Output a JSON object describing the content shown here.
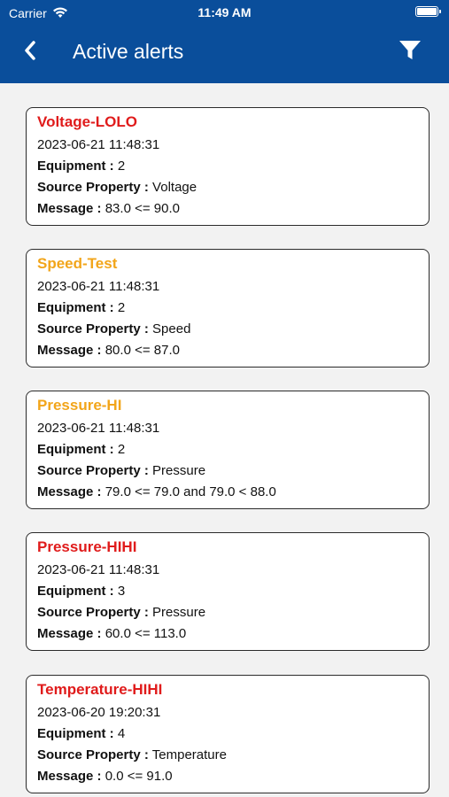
{
  "status_bar": {
    "carrier": "Carrier",
    "time": "11:49 AM"
  },
  "header": {
    "title": "Active alerts",
    "back_icon": "chevron-left-icon",
    "filter_icon": "filter-icon"
  },
  "colors": {
    "header_bg": "#0a4e9b",
    "critical": "#e01b1b",
    "warning": "#f2a51a"
  },
  "labels": {
    "equipment": "Equipment :",
    "source_property": "Source Property :",
    "message": "Message :"
  },
  "alerts": [
    {
      "title": "Voltage-LOLO",
      "severity_color": "#e01b1b",
      "timestamp": "2023-06-21 11:48:31",
      "equipment": "2",
      "source_property": "Voltage",
      "message": "83.0 <= 90.0"
    },
    {
      "title": "Speed-Test",
      "severity_color": "#f2a51a",
      "timestamp": "2023-06-21 11:48:31",
      "equipment": "2",
      "source_property": "Speed",
      "message": "80.0 <= 87.0"
    },
    {
      "title": "Pressure-HI",
      "severity_color": "#f2a51a",
      "timestamp": "2023-06-21 11:48:31",
      "equipment": "2",
      "source_property": "Pressure",
      "message": "79.0 <= 79.0 and 79.0 < 88.0"
    },
    {
      "title": "Pressure-HIHI",
      "severity_color": "#e01b1b",
      "timestamp": "2023-06-21 11:48:31",
      "equipment": "3",
      "source_property": "Pressure",
      "message": "60.0 <= 113.0"
    },
    {
      "title": "Temperature-HIHI",
      "severity_color": "#e01b1b",
      "timestamp": "2023-06-20 19:20:31",
      "equipment": "4",
      "source_property": "Temperature",
      "message": "0.0 <= 91.0"
    }
  ]
}
